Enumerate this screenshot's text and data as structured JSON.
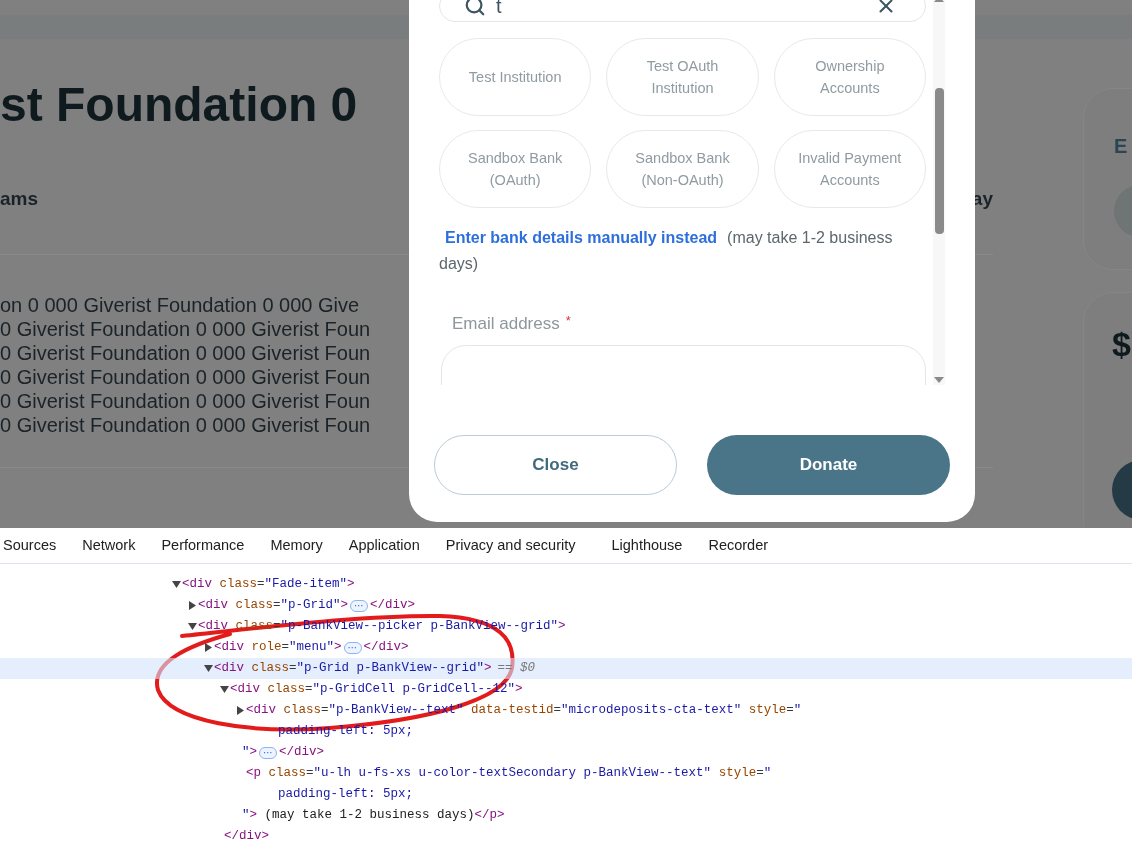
{
  "page": {
    "title": "st Foundation 0",
    "section_left": "ams",
    "section_right": "ay",
    "description_lines": [
      "on 0 000 Giverist Foundation 0 000 Give",
      "0 Giverist Foundation 0 000 Giverist Foun",
      "0 Giverist Foundation 0 000 Giverist Foun",
      "0 Giverist Foundation 0 000 Giverist Foun",
      "0 Giverist Foundation 0 000 Giverist Foun",
      "0 Giverist Foundation 0 000 Giverist Foun"
    ],
    "side_cards": [
      {
        "text": "E"
      },
      {
        "text": "$"
      }
    ]
  },
  "modal": {
    "search": {
      "value": "t"
    },
    "banks": [
      {
        "name": "Test Institution"
      },
      {
        "name": "Test OAuth Institution"
      },
      {
        "name": "Ownership Accounts"
      },
      {
        "name": "Sandbox Bank (OAuth)"
      },
      {
        "name": "Sandbox Bank (Non-OAuth)"
      },
      {
        "name": "Invalid Payment Accounts"
      }
    ],
    "manual_link": "Enter bank details manually instead",
    "manual_note": "(may take 1-2 business days)",
    "email": {
      "label": "Email address",
      "required_mark": "*"
    },
    "buttons": [
      {
        "label": "Close",
        "kind": "secondary"
      },
      {
        "label": "Donate",
        "kind": "primary"
      }
    ]
  },
  "devtools": {
    "tabs": [
      {
        "label": "Sources",
        "selected": false
      },
      {
        "label": "Network",
        "selected": false
      },
      {
        "label": "Performance",
        "selected": false
      },
      {
        "label": "Memory",
        "selected": false
      },
      {
        "label": "Application",
        "selected": false
      },
      {
        "label": "Privacy and security",
        "selected": false
      },
      {
        "label": "Lighthouse",
        "selected": false
      },
      {
        "label": "Recorder",
        "selected": false
      }
    ],
    "nodes": [
      {
        "lines": [
          "<div class=\"Fade-item\">"
        ],
        "expanded": true,
        "selected": false,
        "children": [
          {
            "lines": [
              "<div class=\"p-Grid\">"
            ],
            "ellipsis": "⋯",
            "close": "</div>",
            "expanded": false,
            "selected": false
          },
          {
            "lines": [
              "<div class=\"p-BankView--picker p-BankView--grid\">"
            ],
            "expanded": true,
            "selected": false,
            "children": [
              {
                "lines": [
                  "<div role=\"menu\">"
                ],
                "ellipsis": "⋯",
                "close": "</div>",
                "expanded": false,
                "selected": false
              },
              {
                "lines": [
                  "<div class=\"p-Grid p-BankView--grid\">"
                ],
                "suffix": "== $0",
                "expanded": true,
                "selected": true,
                "children": [
                  {
                    "lines": [
                      "<div class=\"p-GridCell p-GridCell--12\">"
                    ],
                    "expanded": true,
                    "selected": false,
                    "close": "</div>",
                    "children": [
                      {
                        "lines": [
                          "<div class=\"p-BankView--text\" data-testid=\"microdeposits-cta-text\" style=\"",
                          "padding-left: 5px;",
                          "\">"
                        ],
                        "ellipsis": "⋯",
                        "close": "</div>",
                        "expanded": false,
                        "selected": false
                      },
                      {
                        "lines": [
                          "<p class=\"u-lh u-fs-xs u-color-textSecondary p-BankView--text\" style=\"",
                          "padding-left: 5px;",
                          "\"> (may take 1-2 business days)</p>"
                        ],
                        "selected": false
                      }
                    ]
                  }
                ]
              }
            ]
          }
        ]
      }
    ]
  }
}
